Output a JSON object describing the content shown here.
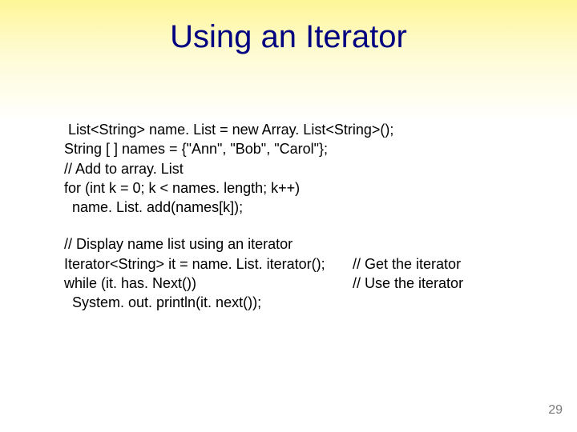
{
  "title": "Using an Iterator",
  "block1": {
    "l1": " List<String> name. List = new Array. List<String>();",
    "l2": "String [ ] names = {\"Ann\", \"Bob\", \"Carol\"};",
    "l3": "// Add to array. List",
    "l4": "for (int k = 0; k < names. length; k++)",
    "l5": "  name. List. add(names[k]);"
  },
  "block2": {
    "l1": "// Display name list using an iterator",
    "row1_left": "Iterator<String> it = name. List. iterator();",
    "row1_right": "// Get the iterator",
    "row2_left": "while (it. has. Next())",
    "row2_right": "// Use the iterator",
    "l4": "  System. out. println(it. next());"
  },
  "page_number": "29"
}
